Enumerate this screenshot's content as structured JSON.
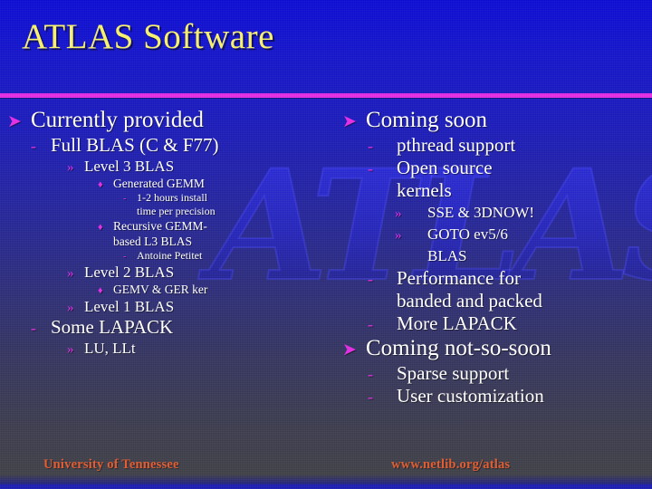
{
  "slide": {
    "title": "ATLAS Software",
    "watermark_text": "ATLAS",
    "colors": {
      "title": "#f6ef6b",
      "rule": "#e12ae1",
      "bullet": "#e12ae1",
      "body_text": "#ffffff",
      "footer": "#e0582c",
      "background_top": "#0a0ad2",
      "background_bottom": "#3e3e46"
    }
  },
  "bullet_glyphs": {
    "arrow": "➤",
    "dash": "-",
    "chevron": "»",
    "diamond": "♦"
  },
  "left_column": [
    {
      "level": 0,
      "glyph": "arrow",
      "text": "Currently provided"
    },
    {
      "level": 1,
      "glyph": "dash",
      "text": "Full BLAS (C & F77)"
    },
    {
      "level": 2,
      "glyph": "chevron",
      "text": "Level 3 BLAS"
    },
    {
      "level": 3,
      "glyph": "diamond",
      "text": "Generated GEMM"
    },
    {
      "level": 4,
      "glyph": "dash",
      "text": "1-2 hours install"
    },
    {
      "level": 4,
      "glyph": "none",
      "text": "time per precision"
    },
    {
      "level": 3,
      "glyph": "diamond",
      "text": "Recursive GEMM-"
    },
    {
      "level": 3,
      "glyph": "none",
      "text": "based L3 BLAS"
    },
    {
      "level": 4,
      "glyph": "dash",
      "text": "Antoine Petitet"
    },
    {
      "level": 2,
      "glyph": "chevron",
      "text": "Level 2 BLAS"
    },
    {
      "level": 3,
      "glyph": "diamond",
      "text": "GEMV & GER ker"
    },
    {
      "level": 2,
      "glyph": "chevron",
      "text": "Level 1 BLAS"
    },
    {
      "level": 1,
      "glyph": "dash",
      "text": "Some LAPACK"
    },
    {
      "level": 2,
      "glyph": "chevron",
      "text": "LU, LLt"
    }
  ],
  "right_column": [
    {
      "level": 0,
      "glyph": "arrow",
      "text": "Coming soon"
    },
    {
      "level": 1,
      "glyph": "dash",
      "text": "pthread support"
    },
    {
      "level": 1,
      "glyph": "dash",
      "text": "Open source"
    },
    {
      "level": 1,
      "glyph": "none",
      "text": "kernels"
    },
    {
      "level": 2,
      "glyph": "chevron",
      "text": "SSE & 3DNOW!"
    },
    {
      "level": 2,
      "glyph": "chevron",
      "text": "GOTO ev5/6"
    },
    {
      "level": 2,
      "glyph": "none",
      "text": "BLAS"
    },
    {
      "level": 1,
      "glyph": "dash",
      "text": "Performance for"
    },
    {
      "level": 1,
      "glyph": "none",
      "text": "banded and packed"
    },
    {
      "level": 1,
      "glyph": "dash",
      "text": "More LAPACK"
    },
    {
      "level": 0,
      "glyph": "arrow",
      "text": "Coming not-so-soon"
    },
    {
      "level": 1,
      "glyph": "dash",
      "text": "Sparse support"
    },
    {
      "level": 1,
      "glyph": "dash",
      "text": "User customization"
    }
  ],
  "footer": {
    "left": "University of Tennessee",
    "right": "www.netlib.org/atlas"
  }
}
